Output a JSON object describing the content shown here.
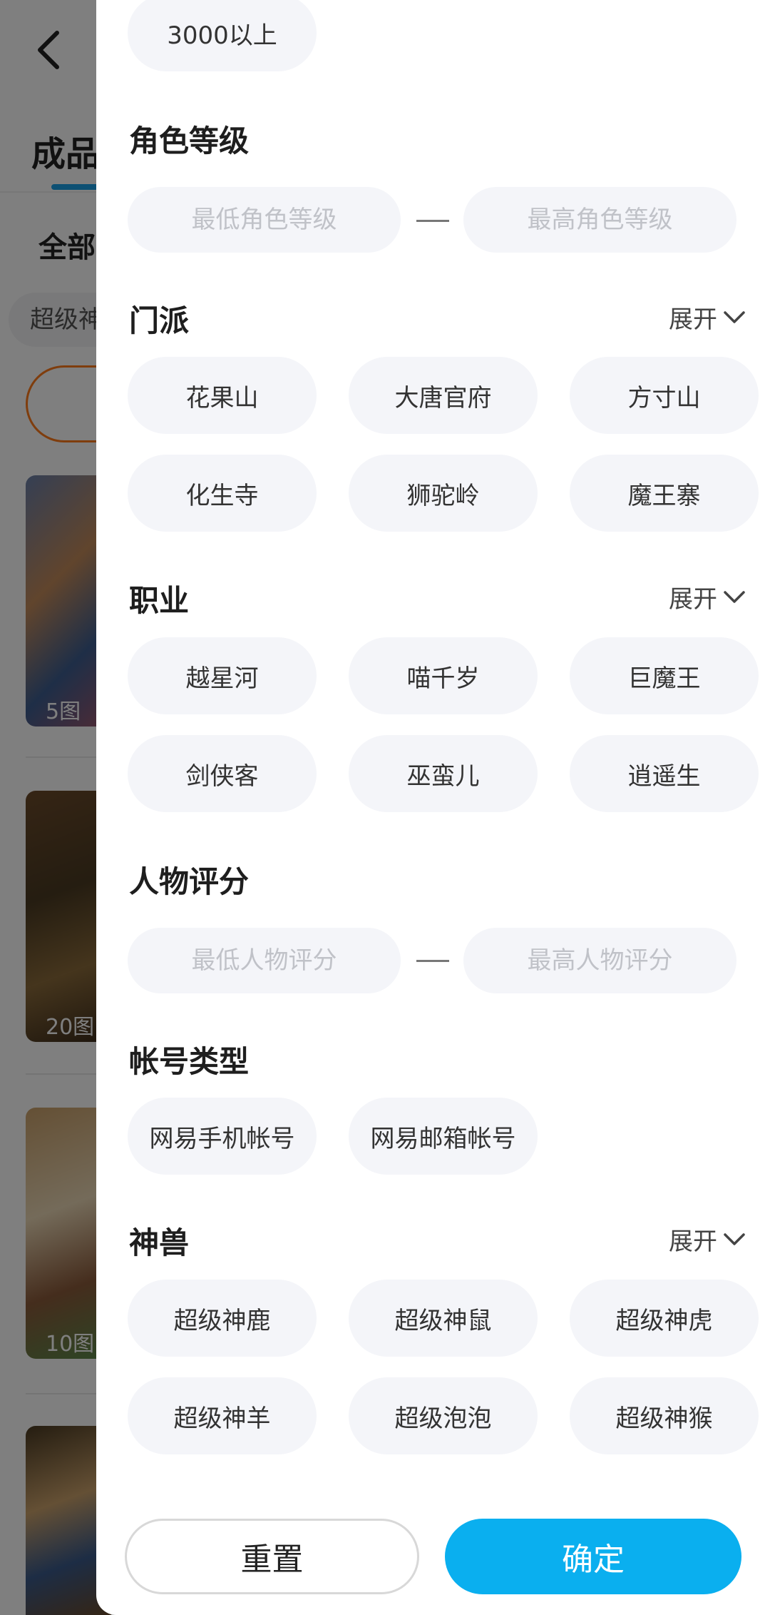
{
  "background": {
    "tab_label": "成品",
    "filter_label": "全部",
    "chip_label": "超级神",
    "cards": [
      {
        "count": "5图"
      },
      {
        "count": "20图"
      },
      {
        "count": "10图"
      }
    ]
  },
  "filter": {
    "price_option_top": "3000以上",
    "role_level": {
      "title": "角色等级",
      "min_placeholder": "最低角色等级",
      "max_placeholder": "最高角色等级"
    },
    "sect": {
      "title": "门派",
      "expand": "展开",
      "options": [
        "花果山",
        "大唐官府",
        "方寸山",
        "化生寺",
        "狮驼岭",
        "魔王寨"
      ]
    },
    "profession": {
      "title": "职业",
      "expand": "展开",
      "options": [
        "越星河",
        "喵千岁",
        "巨魔王",
        "剑侠客",
        "巫蛮儿",
        "逍遥生"
      ]
    },
    "score": {
      "title": "人物评分",
      "min_placeholder": "最低人物评分",
      "max_placeholder": "最高人物评分"
    },
    "account_type": {
      "title": "帐号类型",
      "options": [
        "网易手机帐号",
        "网易邮箱帐号"
      ]
    },
    "beast": {
      "title": "神兽",
      "expand": "展开",
      "options": [
        "超级神鹿",
        "超级神鼠",
        "超级神虎",
        "超级神羊",
        "超级泡泡",
        "超级神猴"
      ]
    }
  },
  "footer": {
    "reset_label": "重置",
    "confirm_label": "确定"
  },
  "colors": {
    "accent": "#0aafef",
    "chip_bg": "#f4f5f9",
    "tab_indicator": "#1aa0e6",
    "outline_orange": "#ff7a1a"
  }
}
